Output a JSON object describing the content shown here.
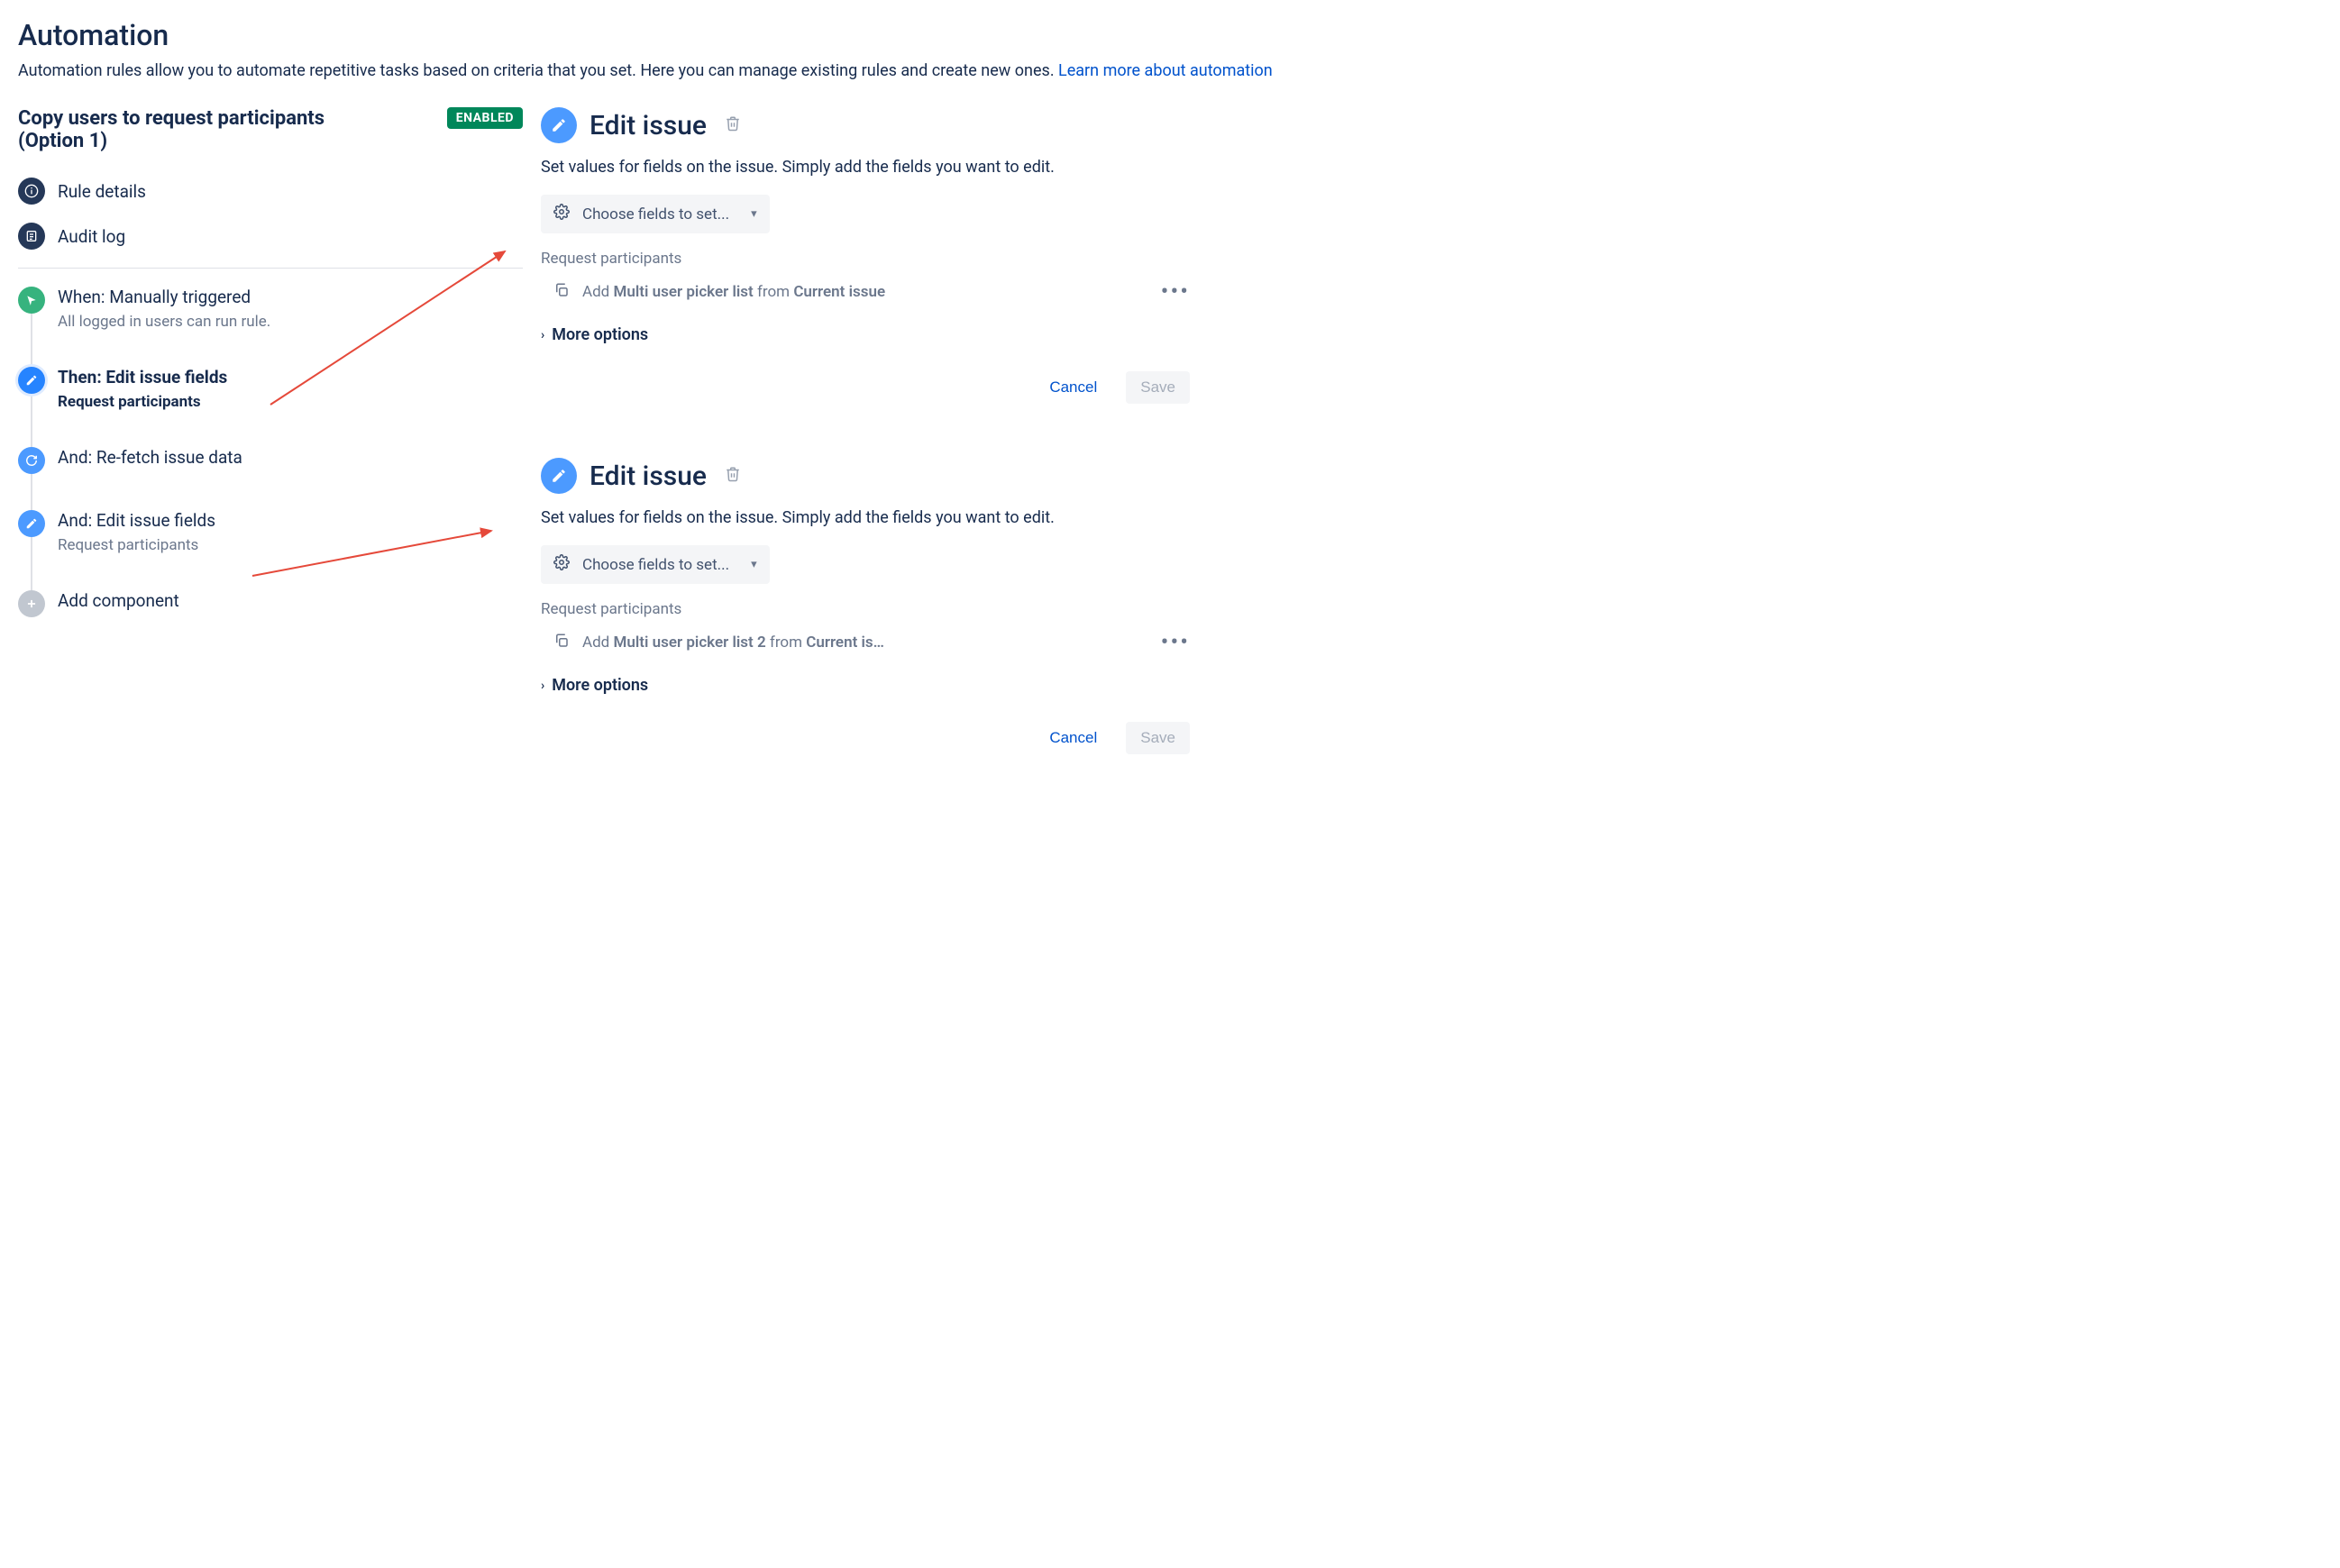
{
  "header": {
    "title": "Automation",
    "subtitle_text": "Automation rules allow you to automate repetitive tasks based on criteria that you set. Here you can manage existing rules and create new ones. ",
    "subtitle_link": "Learn more about automation"
  },
  "rule": {
    "name": "Copy users to request participants (Option 1)",
    "status": "ENABLED"
  },
  "nav": {
    "rule_details": "Rule details",
    "audit_log": "Audit log"
  },
  "steps": {
    "trigger": {
      "title": "When: Manually triggered",
      "sub": "All logged in users can run rule."
    },
    "then_edit": {
      "title": "Then: Edit issue fields",
      "sub": "Request participants"
    },
    "refetch": {
      "title": "And: Re-fetch issue data"
    },
    "and_edit": {
      "title": "And: Edit issue fields",
      "sub": "Request participants"
    },
    "add_component": {
      "title": "Add component"
    }
  },
  "panel1": {
    "title": "Edit issue",
    "desc": "Set values for fields on the issue. Simply add the fields you want to edit.",
    "choose": "Choose fields to set...",
    "field_label": "Request participants",
    "add_prefix": "Add ",
    "add_bold": "Multi user picker list",
    "add_mid": " from ",
    "add_bold2": "Current issue",
    "more": "More options",
    "cancel": "Cancel",
    "save": "Save"
  },
  "panel2": {
    "title": "Edit issue",
    "desc": "Set values for fields on the issue. Simply add the fields you want to edit.",
    "choose": "Choose fields to set...",
    "field_label": "Request participants",
    "add_prefix": "Add ",
    "add_bold": "Multi user picker list 2",
    "add_mid": " from ",
    "add_bold2": "Current is…",
    "more": "More options",
    "cancel": "Cancel",
    "save": "Save"
  }
}
